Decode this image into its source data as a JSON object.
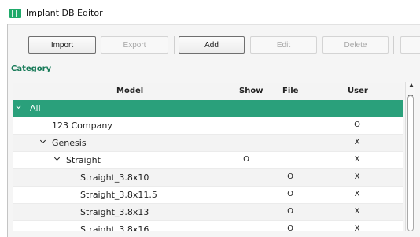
{
  "window": {
    "title": "Implant DB Editor"
  },
  "toolbar": {
    "import_label": "Import",
    "export_label": "Export",
    "add_label": "Add",
    "edit_label": "Edit",
    "delete_label": "Delete"
  },
  "section": {
    "category_label": "Category"
  },
  "table": {
    "columns": {
      "model": "Model",
      "show": "Show",
      "file": "File",
      "user": "User"
    },
    "rows": [
      {
        "name": "All",
        "show": "",
        "file": "",
        "user": ""
      },
      {
        "name": "123 Company",
        "show": "",
        "file": "",
        "user": "O"
      },
      {
        "name": "Genesis",
        "show": "",
        "file": "",
        "user": "X"
      },
      {
        "name": "Straight",
        "show": "O",
        "file": "",
        "user": "X"
      },
      {
        "name": "Straight_3.8x10",
        "show": "",
        "file": "O",
        "user": "X"
      },
      {
        "name": "Straight_3.8x11.5",
        "show": "",
        "file": "O",
        "user": "X"
      },
      {
        "name": "Straight_3.8x13",
        "show": "",
        "file": "O",
        "user": "X"
      },
      {
        "name": "Straight_3.8x16",
        "show": "",
        "file": "O",
        "user": "X"
      }
    ]
  },
  "colors": {
    "accent": "#2aa07b",
    "category_text": "#177a58",
    "app_icon": "#1faa6a"
  },
  "icons": {
    "app": "implant-db-icon",
    "expand": "chevron-down-icon",
    "scroll_up": "scroll-up-arrow-icon"
  }
}
